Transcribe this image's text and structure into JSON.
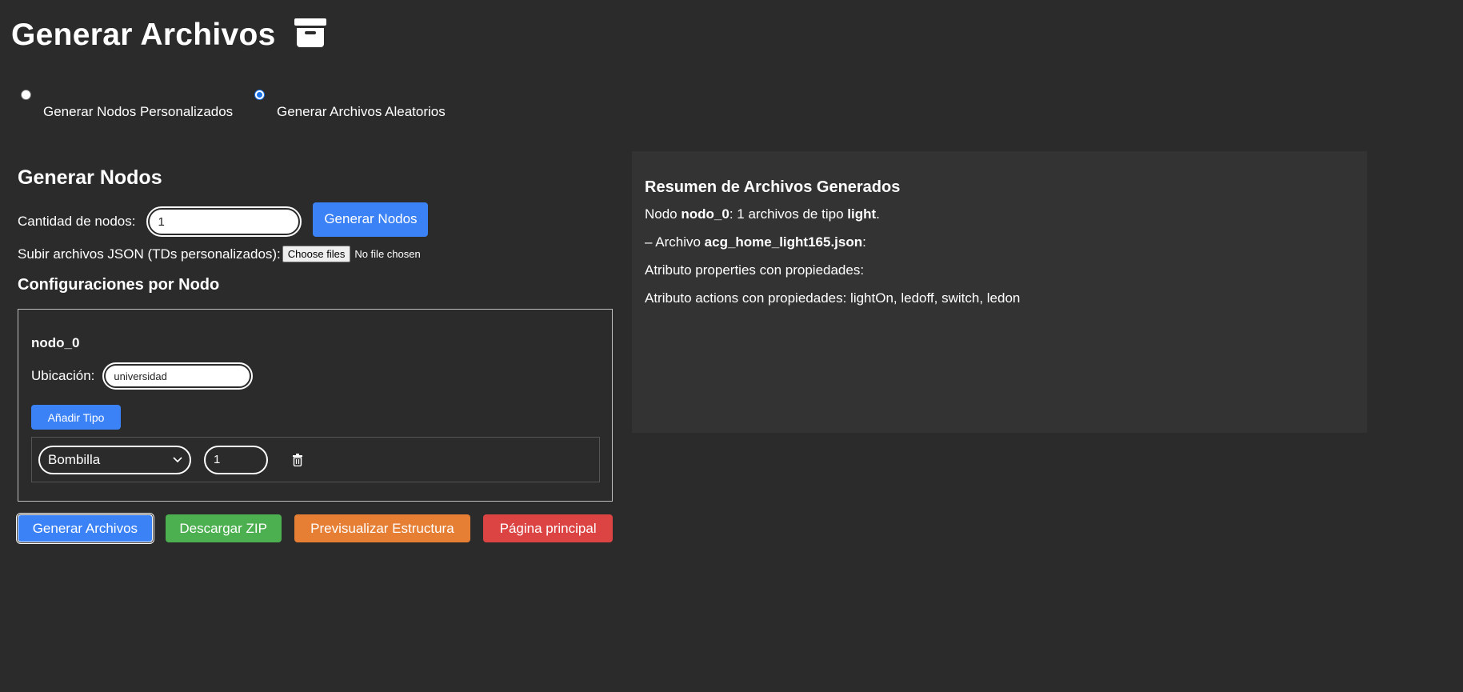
{
  "header": {
    "title": "Generar Archivos",
    "icon": "archive-box-icon"
  },
  "mode": {
    "options": [
      {
        "label": "Generar Nodos Personalizados",
        "checked": false
      },
      {
        "label": "Generar Archivos Aleatorios",
        "checked": true
      }
    ]
  },
  "generator": {
    "heading": "Generar Nodos",
    "count_label": "Cantidad de nodos:",
    "count_value": "1",
    "generate_button": "Generar Nodos",
    "upload_label": "Subir archivos JSON (TDs personalizados):",
    "upload_button": "Choose files",
    "upload_status": "No file chosen"
  },
  "config": {
    "heading": "Configuraciones por Nodo",
    "node": {
      "name": "nodo_0",
      "location_label": "Ubicación:",
      "location_value": "universidad",
      "add_type_button": "Añadir Tipo",
      "types": [
        {
          "type": "Bombilla",
          "count": "1"
        }
      ]
    }
  },
  "actions": {
    "generate_files": "Generar Archivos",
    "download_zip": "Descargar ZIP",
    "preview": "Previsualizar Estructura",
    "home": "Página principal"
  },
  "summary": {
    "heading": "Resumen de Archivos Generados",
    "line1": {
      "prefix": "Nodo ",
      "node": "nodo_0",
      "middle": ": 1 archivos de tipo ",
      "type": "light",
      "suffix": "."
    },
    "line2": {
      "prefix": "– Archivo ",
      "file": "acg_home_light165.json",
      "suffix": ":"
    },
    "line3": "Atributo properties con propiedades:",
    "line4": "Atributo actions con propiedades: lightOn, ledoff, switch, ledon"
  },
  "colors": {
    "background": "#2b2b2b",
    "panel": "#333333",
    "blue": "#3b82f6",
    "green": "#4caf50",
    "orange": "#e67e33",
    "red": "#dc4444"
  }
}
